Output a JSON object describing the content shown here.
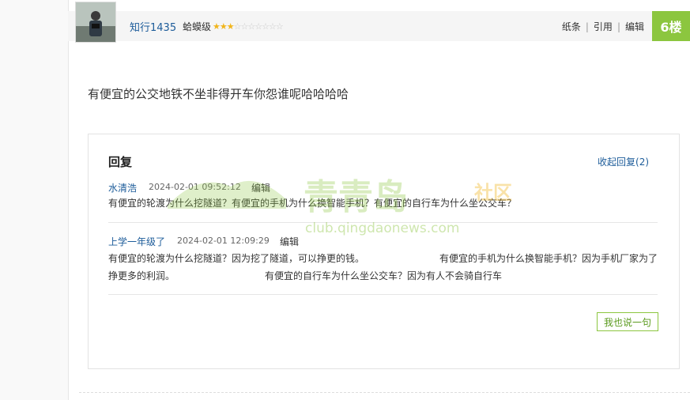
{
  "post": {
    "username": "知行1435",
    "level": "蛤蟆级",
    "stars_filled": 3,
    "stars_total": 10,
    "actions": [
      "纸条",
      "引用",
      "编辑"
    ],
    "floor": "6楼",
    "content": "有便宜的公交地铁不坐非得开车你怨谁呢哈哈哈哈"
  },
  "replies": {
    "title": "回复",
    "collapse_label": "收起回复",
    "collapse_count": "(2)",
    "items": [
      {
        "user": "水清浩",
        "time": "2024-02-01 09:52:12",
        "edit": "编辑",
        "text": "有便宜的轮渡为什么挖隧道？有便宜的手机为什么换智能手机？有便宜的自行车为什么坐公交车？"
      },
      {
        "user": "上学一年级了",
        "time": "2024-02-01 12:09:29",
        "edit": "编辑",
        "text_line1a": "有便宜的轮渡为什么挖隧道？因为挖了隧道，可以挣更的钱。",
        "text_line1b": "有便宜的手机为什么换智能手机？因为手机厂家为了",
        "text_line2a": "挣更多的利润。",
        "text_line2b": "有便宜的自行车为什么坐公交车？因为有人不会骑自行车"
      }
    ],
    "say_button": "我也说一句"
  },
  "watermark": {
    "brand": "青青岛",
    "tag": "社区",
    "url": "club.qingdaonews.com"
  },
  "colors": {
    "accent_green": "#8cc63f",
    "link_blue": "#1d5c9a",
    "star_gold": "#f1b51c"
  }
}
